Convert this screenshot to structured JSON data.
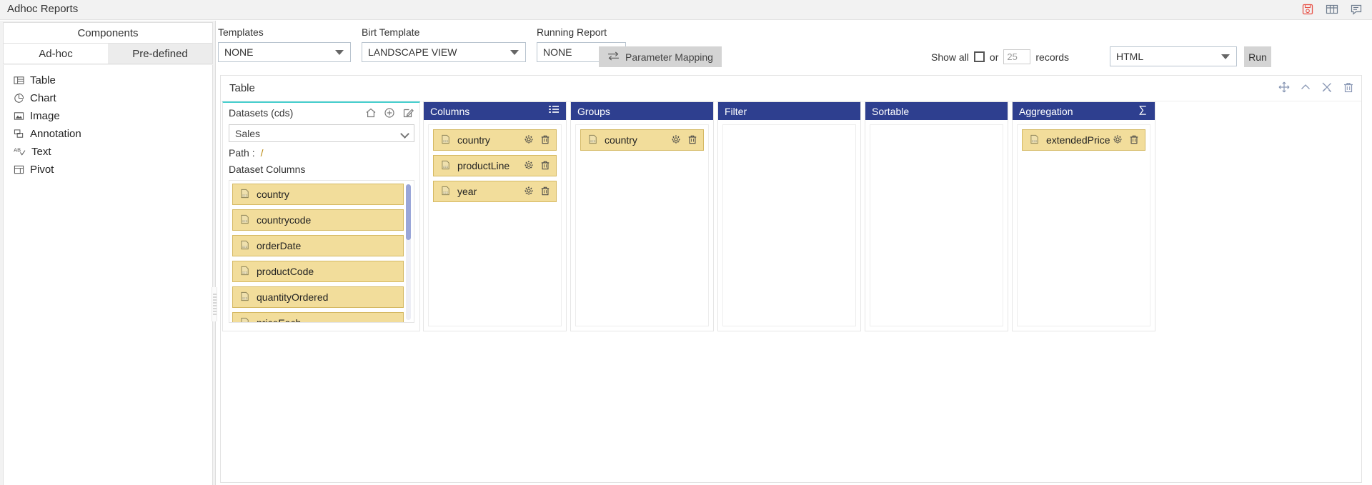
{
  "app": {
    "title": "Adhoc Reports",
    "top_icons": [
      {
        "name": "save-report-icon",
        "label": "save"
      },
      {
        "name": "grid-view-icon",
        "label": "grid"
      },
      {
        "name": "comment-icon",
        "label": "comment"
      }
    ]
  },
  "sidebar": {
    "header": "Components",
    "tabs": [
      {
        "label": "Ad-hoc",
        "active": true
      },
      {
        "label": "Pre-defined",
        "active": false
      }
    ],
    "items": [
      {
        "label": "Table",
        "icon": "table-icon"
      },
      {
        "label": "Chart",
        "icon": "pie-chart-icon"
      },
      {
        "label": "Image",
        "icon": "image-icon"
      },
      {
        "label": "Annotation",
        "icon": "annotation-icon"
      },
      {
        "label": "Text",
        "icon": "text-ab-icon"
      },
      {
        "label": "Pivot",
        "icon": "pivot-icon"
      }
    ]
  },
  "toolbar": {
    "templates": {
      "label": "Templates",
      "value": "NONE"
    },
    "birt_template": {
      "label": "Birt Template",
      "value": "LANDSCAPE VIEW"
    },
    "running_report": {
      "label": "Running Report",
      "value": "NONE"
    },
    "parameter_mapping_button": "Parameter Mapping",
    "show_all_label": "Show all",
    "show_all_checked": false,
    "or_label": "or",
    "records_value": "25",
    "records_label": "records",
    "format_value": "HTML",
    "run_button": "Run"
  },
  "card": {
    "title": "Table",
    "tools": [
      {
        "name": "move-icon"
      },
      {
        "name": "collapse-chevron-up-icon"
      },
      {
        "name": "settings-tools-icon"
      },
      {
        "name": "delete-trash-icon"
      }
    ]
  },
  "datasets": {
    "title": "Datasets (cds)",
    "icons": [
      {
        "name": "home-icon"
      },
      {
        "name": "add-circle-icon"
      },
      {
        "name": "edit-icon"
      }
    ],
    "selected": "Sales",
    "path_label": "Path :",
    "path_value": "/",
    "columns_label": "Dataset Columns",
    "columns": [
      "country",
      "countrycode",
      "orderDate",
      "productCode",
      "quantityOrdered",
      "priceEach"
    ]
  },
  "panels": [
    {
      "title": "Columns",
      "header_icon": "list-lines-icon",
      "items": [
        "country",
        "productLine",
        "year"
      ]
    },
    {
      "title": "Groups",
      "header_icon": "",
      "items": [
        "country"
      ]
    },
    {
      "title": "Filter",
      "header_icon": "",
      "items": []
    },
    {
      "title": "Sortable",
      "header_icon": "",
      "items": []
    },
    {
      "title": "Aggregation",
      "header_icon": "sigma-icon",
      "items": [
        "extendedPrice"
      ]
    }
  ],
  "colors": {
    "panel_header": "#2e3f8f",
    "chip_bg": "#f2dd9b",
    "chip_border": "#d5b963",
    "accent_teal": "#48cfce",
    "button_grey": "#d4d4d4"
  }
}
